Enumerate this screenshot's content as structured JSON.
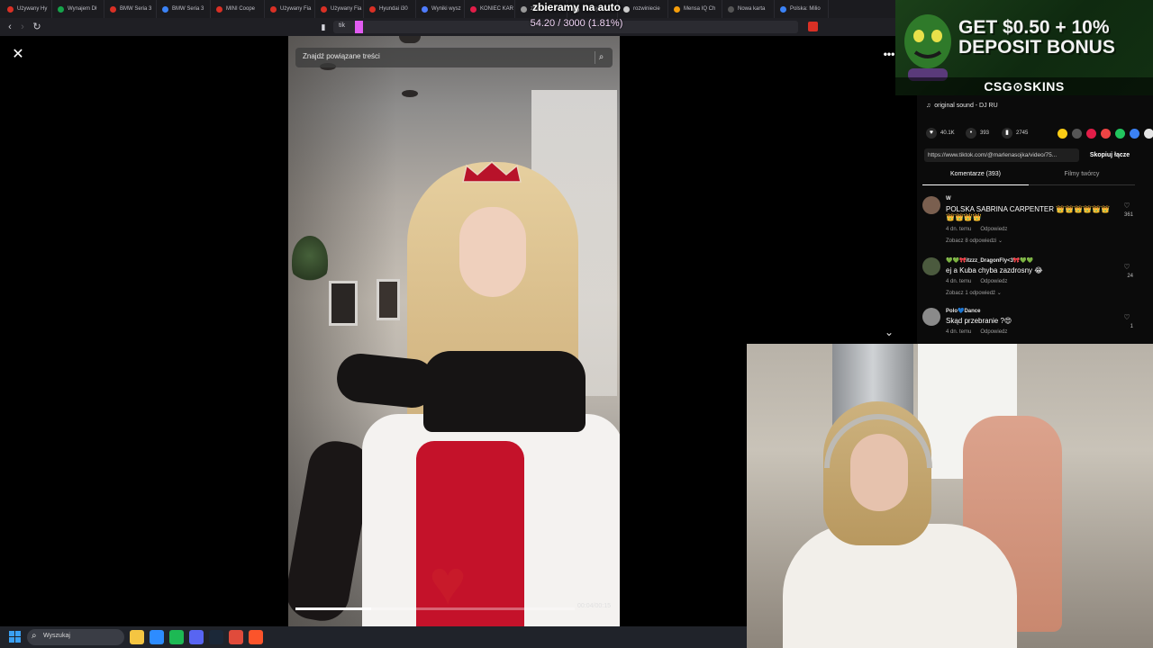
{
  "browser": {
    "tabs": [
      {
        "label": "Używany Hy",
        "color": "#d93025"
      },
      {
        "label": "Wynajem Dł",
        "color": "#16a34a"
      },
      {
        "label": "BMW Seria 3",
        "color": "#d93025"
      },
      {
        "label": "BMW Seria 3",
        "color": "#3b82f6"
      },
      {
        "label": "MINI Coope",
        "color": "#d93025"
      },
      {
        "label": "Używany Fia",
        "color": "#d93025"
      },
      {
        "label": "Używany Fia",
        "color": "#d93025"
      },
      {
        "label": "Hyundai i30",
        "color": "#d93025"
      },
      {
        "label": "Wyniki wysz",
        "color": "#4f7cff"
      },
      {
        "label": "KONIEC KAR",
        "color": "#e11d48"
      },
      {
        "label": "zbieramy na auto - S",
        "color": "#999999"
      },
      {
        "label": "mensy test",
        "color": "#cccccc"
      },
      {
        "label": "rozwiniecie",
        "color": "#cccccc"
      },
      {
        "label": "Mensa IQ Ch",
        "color": "#f59e0b"
      },
      {
        "label": "Nowa karta",
        "color": "#555555"
      },
      {
        "label": "Polska: Milio",
        "color": "#3b82f6"
      }
    ],
    "omnibox_text": "tik"
  },
  "stream": {
    "donation_title": "zbieramy na auto",
    "donation_progress": "54.20 / 3000 (1.81%)",
    "donation_fraction": 0.0181
  },
  "tiktok": {
    "close_icon": "close-icon",
    "more_icon": "more-icon",
    "scroll_down_icon": "chevron-down-icon",
    "related_search_placeholder": "Znajdź powiązane treści",
    "video_time": "00:04/00:15",
    "video_progress": 0.27,
    "sound": "original sound - DJ RU",
    "actions": {
      "likes": "40.1K",
      "comments": "393",
      "saves": "2745"
    },
    "share_colors": [
      "#facc15",
      "#555555",
      "#e11d48",
      "#ef4444",
      "#22c55e",
      "#3b82f6",
      "#e5e5e5"
    ],
    "link": "https://www.tiktok.com/@marlenasojka/video/75...",
    "copy_link_label": "Skopiuj łącze",
    "tab_comments": "Komentarze (393)",
    "tab_creator_videos": "Filmy twórcy",
    "comments": [
      {
        "user": "W",
        "text": "POLSKA SABRINA CARPENTER 👑👑👑👑👑👑👑👑👑👑",
        "time": "4 dn. temu",
        "reply": "Odpowiedz",
        "replies_toggle": "Zobacz 8 odpowiedzi ⌄",
        "likes": "361",
        "avatar_color": "#7a5f4f"
      },
      {
        "user": "💚💚🎀itzzz_DragonFly<3🎀💚💚",
        "text": "ej a Kuba chyba zazdrosny 😂",
        "time": "4 dn. temu",
        "reply": "Odpowiedz",
        "replies_toggle": "Zobacz 1 odpowiedź ⌄",
        "likes": "24",
        "avatar_color": "#4b5a3e"
      },
      {
        "user": "Polo💙Dance",
        "text": "Skąd przebranie ?😍",
        "time": "4 dn. temu",
        "reply": "Odpowiedz",
        "replies_toggle": "",
        "likes": "1",
        "avatar_color": "#8a8a8a"
      }
    ]
  },
  "ad": {
    "headline": "GET $0.50 + 10% DEPOSIT BONUS",
    "brand": "CSG⊙SKINS",
    "bg_color": "#1b4019"
  },
  "taskbar": {
    "search_text": "Wyszukaj",
    "apps": [
      {
        "name": "file-explorer-icon",
        "color": "#f4c542"
      },
      {
        "name": "store-icon",
        "color": "#2d8cff"
      },
      {
        "name": "spotify-icon",
        "color": "#1db954"
      },
      {
        "name": "discord-icon",
        "color": "#5865f2"
      },
      {
        "name": "steam-icon",
        "color": "#1b2838"
      },
      {
        "name": "chrome-icon",
        "color": "#e04b3b"
      },
      {
        "name": "brave-icon",
        "color": "#fb542b"
      }
    ]
  }
}
